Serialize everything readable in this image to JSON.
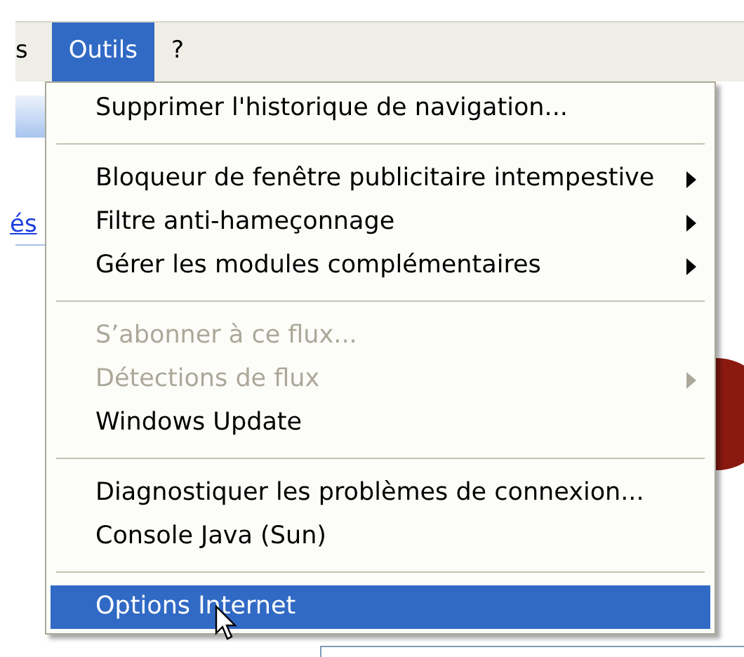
{
  "menu_bar": [
    {
      "label": "s",
      "selected": false
    },
    {
      "label": "Outils",
      "selected": true
    },
    {
      "label": "?",
      "selected": false
    }
  ],
  "page": {
    "link_fragment": "és"
  },
  "menu": [
    {
      "kind": "item",
      "label": "Supprimer l'historique de navigation...",
      "disabled": false,
      "submenu": false,
      "selected": false
    },
    {
      "kind": "separator"
    },
    {
      "kind": "item",
      "label": "Bloqueur de fenêtre publicitaire intempestive",
      "disabled": false,
      "submenu": true,
      "selected": false
    },
    {
      "kind": "item",
      "label": "Filtre anti-hameçonnage",
      "disabled": false,
      "submenu": true,
      "selected": false
    },
    {
      "kind": "item",
      "label": "Gérer les modules complémentaires",
      "disabled": false,
      "submenu": true,
      "selected": false
    },
    {
      "kind": "separator"
    },
    {
      "kind": "item",
      "label": "S’abonner à ce flux...",
      "disabled": true,
      "submenu": false,
      "selected": false
    },
    {
      "kind": "item",
      "label": "Détections de flux",
      "disabled": true,
      "submenu": true,
      "selected": false
    },
    {
      "kind": "item",
      "label": "Windows Update",
      "disabled": false,
      "submenu": false,
      "selected": false
    },
    {
      "kind": "separator"
    },
    {
      "kind": "item",
      "label": "Diagnostiquer les problèmes de connexion...",
      "disabled": false,
      "submenu": false,
      "selected": false
    },
    {
      "kind": "item",
      "label": "Console Java (Sun)",
      "disabled": false,
      "submenu": false,
      "selected": false
    },
    {
      "kind": "separator"
    },
    {
      "kind": "item",
      "label": "Options Internet",
      "disabled": false,
      "submenu": false,
      "selected": true
    }
  ]
}
